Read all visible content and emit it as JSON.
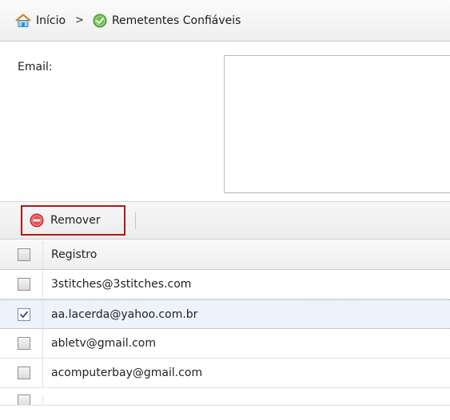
{
  "breadcrumb": {
    "home_label": "Início",
    "separator": ">",
    "current_label": "Remetentes Confiáveis"
  },
  "form": {
    "email_label": "Email:",
    "email_value": ""
  },
  "toolbar": {
    "remove_label": "Remover"
  },
  "table": {
    "header": "Registro",
    "rows": [
      {
        "value": "3stitches@3stitches.com",
        "checked": false
      },
      {
        "value": "aa.lacerda@yahoo.com.br",
        "checked": true
      },
      {
        "value": "abletv@gmail.com",
        "checked": false
      },
      {
        "value": "acomputerbay@gmail.com",
        "checked": false
      }
    ]
  },
  "colors": {
    "remove_highlight": "#b01717",
    "home_icon_roof": "#e08a1e",
    "ok_icon": "#5bb83a",
    "remove_icon": "#e0454a",
    "selected_row_bg": "#eef3fb"
  },
  "icons": {
    "home": "home-icon",
    "current": "check-circle-icon",
    "remove": "minus-circle-icon"
  }
}
